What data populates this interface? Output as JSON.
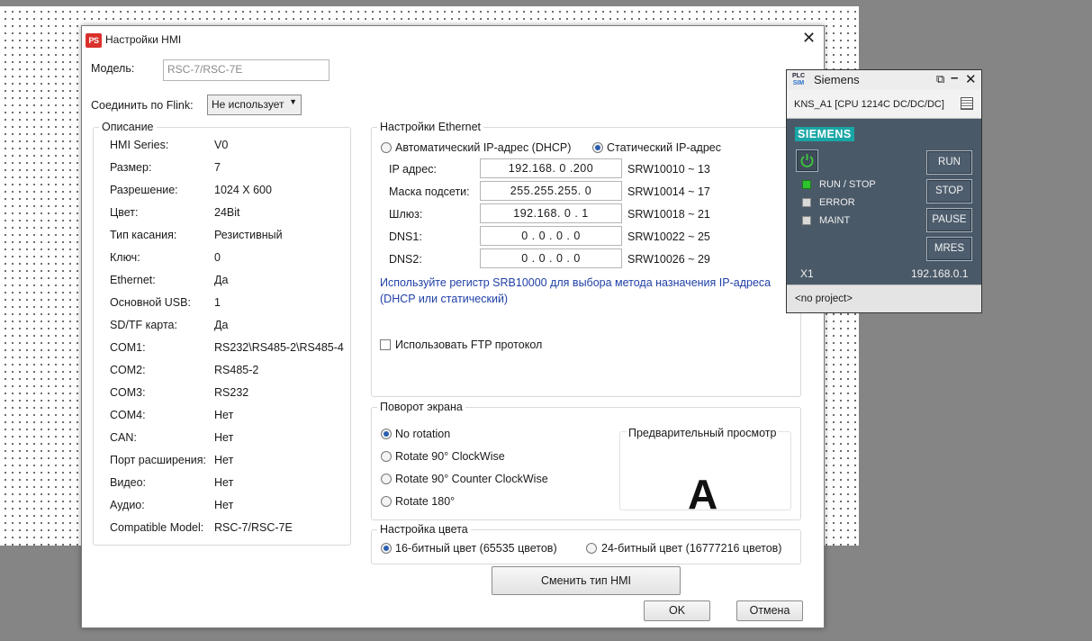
{
  "dialog": {
    "title": "Настройки HMI",
    "model_label": "Модель:",
    "model_value": "RSC-7/RSC-7E",
    "flink_label": "Соединить по Flink:",
    "flink_value": "Не использует",
    "ok_label": "OK",
    "cancel_label": "Отмена",
    "change_type_label": "Сменить тип HMI",
    "icon_text": "PS"
  },
  "description": {
    "title": "Описание",
    "rows": [
      {
        "label": "HMI Series:",
        "value": "V0"
      },
      {
        "label": "Размер:",
        "value": "7"
      },
      {
        "label": "Разрешение:",
        "value": "1024 X 600"
      },
      {
        "label": "Цвет:",
        "value": "24Bit"
      },
      {
        "label": "Тип касания:",
        "value": "Резистивный"
      },
      {
        "label": "Ключ:",
        "value": "0"
      },
      {
        "label": "Ethernet:",
        "value": "Да"
      },
      {
        "label": "Основной USB:",
        "value": "1"
      },
      {
        "label": "SD/TF карта:",
        "value": "Да"
      },
      {
        "label": "COM1:",
        "value": "RS232\\RS485-2\\RS485-4"
      },
      {
        "label": "COM2:",
        "value": "RS485-2"
      },
      {
        "label": "COM3:",
        "value": "RS232"
      },
      {
        "label": "COM4:",
        "value": "Нет"
      },
      {
        "label": "CAN:",
        "value": "Нет"
      },
      {
        "label": "Порт расширения:",
        "value": "Нет"
      },
      {
        "label": "Видео:",
        "value": "Нет"
      },
      {
        "label": "Аудио:",
        "value": "Нет"
      },
      {
        "label": "Compatible Model:",
        "value": "RSC-7/RSC-7E"
      }
    ]
  },
  "ethernet": {
    "title": "Настройки Ethernet",
    "auto_label": "Автоматический IP-адрес (DHCP)",
    "static_label": "Статический IP-адрес",
    "selected_mode": "static",
    "fields": [
      {
        "label": "IP адрес:",
        "value": "192.168. 0 .200",
        "register": "SRW10010 ~ 13"
      },
      {
        "label": "Маска подсети:",
        "value": "255.255.255. 0",
        "register": "SRW10014 ~ 17"
      },
      {
        "label": "Шлюз:",
        "value": "192.168. 0 . 1",
        "register": "SRW10018 ~ 21"
      },
      {
        "label": "DNS1:",
        "value": "0 . 0 . 0 . 0",
        "register": "SRW10022 ~ 25"
      },
      {
        "label": "DNS2:",
        "value": "0 . 0 . 0 . 0",
        "register": "SRW10026 ~ 29"
      }
    ],
    "hint_line1": "Используйте регистр SRB10000 для выбора метода назначения IP-адреса",
    "hint_line2": "(DHCP или статический)",
    "ftp_label": "Использовать FTP протокол",
    "ftp_checked": false
  },
  "rotation": {
    "title": "Поворот экрана",
    "options": [
      "No rotation",
      "Rotate 90° ClockWise",
      "Rotate 90° Counter ClockWise",
      "Rotate 180°"
    ],
    "selected_index": 0,
    "preview_title": "Предварительный просмотр",
    "preview_letter": "A"
  },
  "color": {
    "title": "Настройка цвета",
    "option16": "16-битный цвет (65535 цветов)",
    "option24": "24-битный цвет (16777216 цветов)",
    "selected": "16"
  },
  "plcsim": {
    "title": "Siemens",
    "logo_top": "PLC",
    "logo_bottom": "SIM",
    "project": "KNS_A1 [CPU 1214C DC/DC/DC]",
    "brand": "SIEMENS",
    "buttons": {
      "run": "RUN",
      "stop": "STOP",
      "pause": "PAUSE",
      "mres": "MRES"
    },
    "leds": [
      {
        "label": "RUN / STOP",
        "on": true
      },
      {
        "label": "ERROR",
        "on": false
      },
      {
        "label": "MAINT",
        "on": false
      }
    ],
    "interface": "X1",
    "ip": "192.168.0.1",
    "status": "<no project>",
    "colors": {
      "panel": "#4a5968",
      "brand": "#19a6a6",
      "led_on": "#2ec22e"
    }
  }
}
